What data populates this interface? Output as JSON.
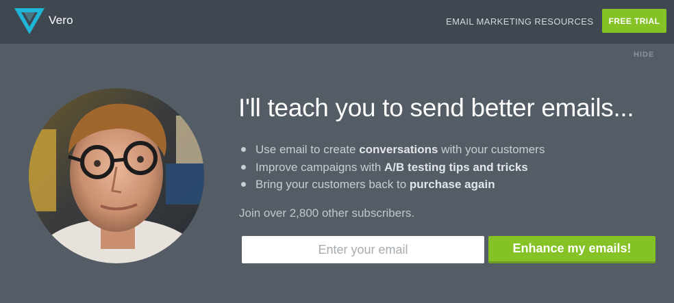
{
  "header": {
    "brand": "Vero",
    "nav_link": "EMAIL MARKETING RESOURCES",
    "trial_button": "FREE TRIAL"
  },
  "banner": {
    "hide_label": "HIDE",
    "headline": "I'll teach you to send better emails...",
    "bullets": [
      {
        "pre": "Use email to create ",
        "bold": "conversations",
        "post": " with your customers"
      },
      {
        "pre": "Improve campaigns with ",
        "bold": "A/B testing tips and tricks",
        "post": ""
      },
      {
        "pre": "Bring your customers back to ",
        "bold": "purchase again",
        "post": ""
      }
    ],
    "subscribers": "Join over 2,800 other subscribers.",
    "email_placeholder": "Enter your email",
    "cta_button": "Enhance my emails!"
  },
  "colors": {
    "topbar": "#3f4850",
    "background": "#545d66",
    "accent_green": "#84c225",
    "logo_teal": "#1fb5d8"
  },
  "icons": {
    "logo": "vero-triangle-logo",
    "avatar": "author-portrait-photo"
  }
}
